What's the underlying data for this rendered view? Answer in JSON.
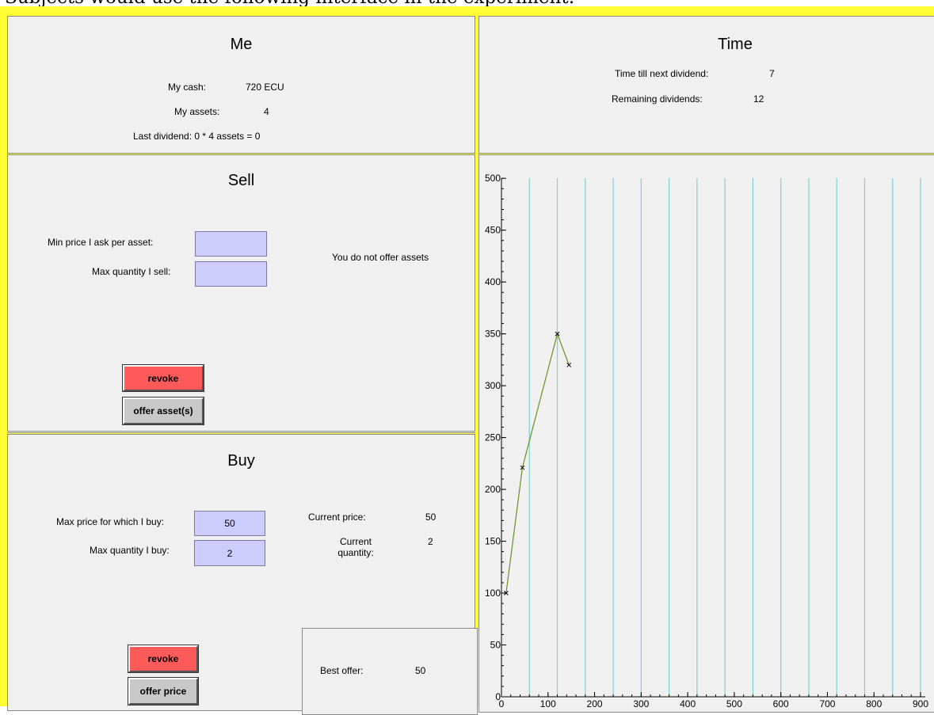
{
  "caption": "Subjects would use the following interface in the experiment:",
  "me": {
    "title": "Me",
    "cash_label": "My cash:",
    "cash_value": "720 ECU",
    "assets_label": "My assets:",
    "assets_value": "4",
    "last_dividend": "Last dividend: 0 * 4 assets = 0"
  },
  "time": {
    "title": "Time",
    "next_dividend_label": "Time till next dividend:",
    "next_dividend_value": "7",
    "remaining_label": "Remaining dividends:",
    "remaining_value": "12"
  },
  "sell": {
    "title": "Sell",
    "min_price_label": "Min price I ask per asset:",
    "min_price_value": "",
    "max_qty_label": "Max quantity I sell:",
    "max_qty_value": "",
    "status": "You do not offer assets",
    "revoke_label": "revoke",
    "offer_label": "offer asset(s)"
  },
  "buy": {
    "title": "Buy",
    "max_price_label": "Max price for which I buy:",
    "max_price_value": "50",
    "max_qty_label": "Max quantity I buy:",
    "max_qty_value": "2",
    "current_price_label": "Current price:",
    "current_price_value": "50",
    "current_qty_label": "Current quantity:",
    "current_qty_value": "2",
    "revoke_label": "revoke",
    "offer_label": "offer price",
    "best_offer_label": "Best offer:",
    "best_offer_value": "50"
  },
  "colors": {
    "frame": "#ffff33",
    "panel": "#f0f0f0",
    "input": "#ccccff",
    "revoke": "#ff5a5a",
    "gridline": "#7fd0d0",
    "series": "#6b8e23"
  },
  "chart_data": {
    "type": "line",
    "x": [
      10,
      45,
      120,
      145
    ],
    "y": [
      100,
      221,
      350,
      320
    ],
    "xlim": [
      0,
      900
    ],
    "ylim": [
      0,
      500
    ],
    "xticks": [
      0,
      100,
      200,
      300,
      400,
      500,
      600,
      700,
      800,
      900
    ],
    "yticks": [
      0,
      50,
      100,
      150,
      200,
      250,
      300,
      350,
      400,
      450,
      500
    ],
    "vertical_gridlines_x": [
      60,
      120,
      180,
      240,
      300,
      360,
      420,
      480,
      540,
      600,
      660,
      720,
      780,
      840,
      900
    ],
    "grid": "vertical",
    "markers": "x"
  }
}
